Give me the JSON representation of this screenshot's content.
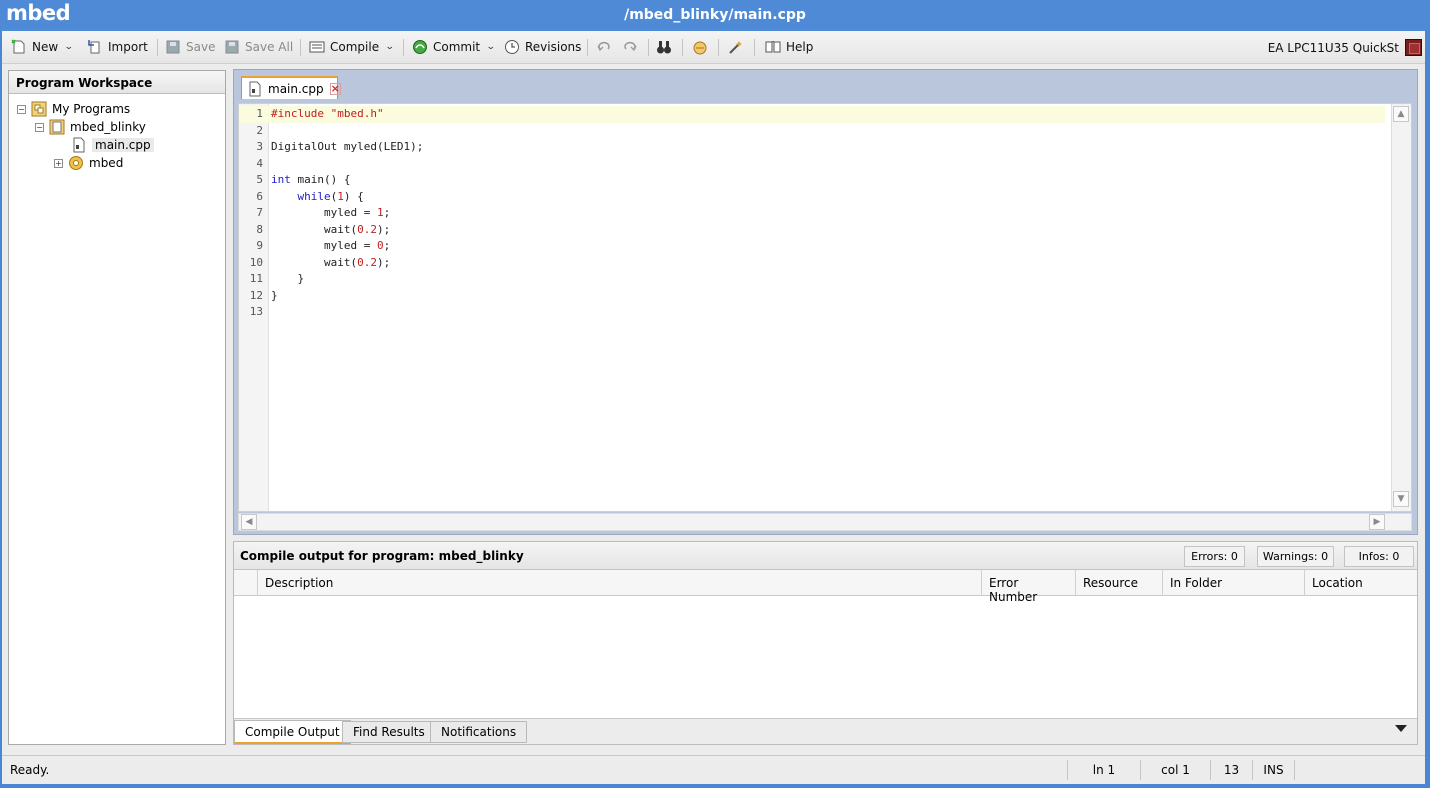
{
  "app": {
    "logo": "mbed",
    "document_title": "/mbed_blinky/main.cpp"
  },
  "toolbar": {
    "new": "New",
    "import": "Import",
    "save": "Save",
    "save_all": "Save All",
    "compile": "Compile",
    "commit": "Commit",
    "revisions": "Revisions",
    "help": "Help",
    "board": "EA LPC11U35 QuickSt"
  },
  "workspace": {
    "title": "Program Workspace",
    "tree": {
      "root": "My Programs",
      "program": "mbed_blinky",
      "file": "main.cpp",
      "library": "mbed"
    }
  },
  "editor": {
    "tab_label": "main.cpp",
    "lines": [
      "#include \"mbed.h\"",
      "",
      "DigitalOut myled(LED1);",
      "",
      "int main() {",
      "    while(1) {",
      "        myled = 1;",
      "        wait(0.2);",
      "        myled = 0;",
      "        wait(0.2);",
      "    }",
      "}",
      ""
    ]
  },
  "output": {
    "title": "Compile output for program: mbed_blinky",
    "errors": "Errors: 0",
    "warnings": "Warnings: 0",
    "infos": "Infos: 0",
    "columns": [
      "Description",
      "Error Number",
      "Resource",
      "In Folder",
      "Location"
    ],
    "tabs": [
      "Compile Output",
      "Find Results",
      "Notifications"
    ]
  },
  "status": {
    "message": "Ready.",
    "line": "ln 1",
    "column": "col 1",
    "line_count": "13",
    "mode": "INS"
  }
}
